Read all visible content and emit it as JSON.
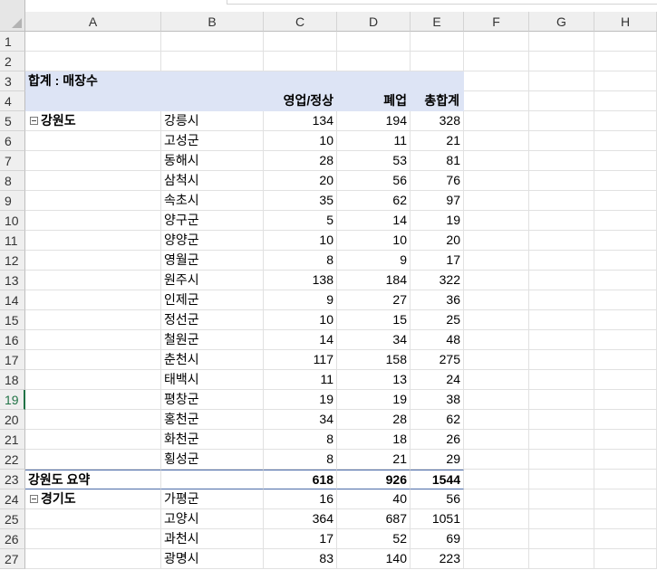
{
  "columns": [
    "A",
    "B",
    "C",
    "D",
    "E",
    "F",
    "G",
    "H"
  ],
  "pivot": {
    "title": "합계 : 매장수",
    "headers": [
      "영업/정상",
      "폐업",
      "총합계"
    ],
    "groups": [
      {
        "region": "강원도",
        "rows": [
          [
            "강릉시",
            "134",
            "194",
            "328"
          ],
          [
            "고성군",
            "10",
            "11",
            "21"
          ],
          [
            "동해시",
            "28",
            "53",
            "81"
          ],
          [
            "삼척시",
            "20",
            "56",
            "76"
          ],
          [
            "속초시",
            "35",
            "62",
            "97"
          ],
          [
            "양구군",
            "5",
            "14",
            "19"
          ],
          [
            "양양군",
            "10",
            "10",
            "20"
          ],
          [
            "영월군",
            "8",
            "9",
            "17"
          ],
          [
            "원주시",
            "138",
            "184",
            "322"
          ],
          [
            "인제군",
            "9",
            "27",
            "36"
          ],
          [
            "정선군",
            "10",
            "15",
            "25"
          ],
          [
            "철원군",
            "14",
            "34",
            "48"
          ],
          [
            "춘천시",
            "117",
            "158",
            "275"
          ],
          [
            "태백시",
            "11",
            "13",
            "24"
          ],
          [
            "평창군",
            "19",
            "19",
            "38"
          ],
          [
            "홍천군",
            "34",
            "28",
            "62"
          ],
          [
            "화천군",
            "8",
            "18",
            "26"
          ],
          [
            "횡성군",
            "8",
            "21",
            "29"
          ]
        ],
        "summary": [
          "강원도 요약",
          "618",
          "926",
          "1544"
        ]
      },
      {
        "region": "경기도",
        "rows": [
          [
            "가평군",
            "16",
            "40",
            "56"
          ],
          [
            "고양시",
            "364",
            "687",
            "1051"
          ],
          [
            "과천시",
            "17",
            "52",
            "69"
          ],
          [
            "광명시",
            "83",
            "140",
            "223"
          ]
        ]
      }
    ]
  }
}
